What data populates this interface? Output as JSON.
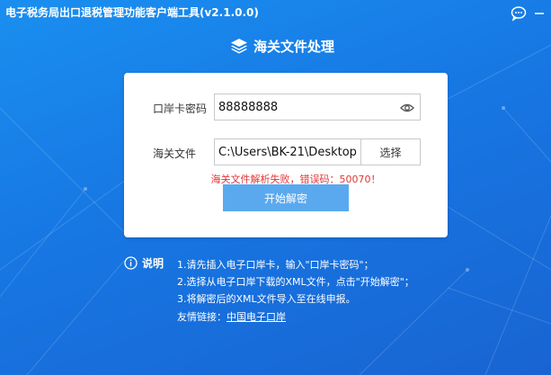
{
  "window": {
    "title": "电子税务局出口退税管理功能客户端工具(v2.1.0.0)"
  },
  "page": {
    "heading": "海关文件处理"
  },
  "form": {
    "password_label": "口岸卡密码",
    "password_value": "88888888",
    "file_label": "海关文件",
    "file_value": "C:\\Users\\BK-21\\Desktop",
    "browse_label": "选择",
    "error_text": "海关文件解析失败，错误码：50070！",
    "decrypt_label": "开始解密"
  },
  "info": {
    "title": "说明",
    "lines": [
      "1.请先插入电子口岸卡，输入\"口岸卡密码\"；",
      "2.选择从电子口岸下载的XML文件，点击\"开始解密\"；",
      "3.将解密后的XML文件导入至在线申报。"
    ],
    "friend_links_label": "友情链接：",
    "friend_link_text": "中国电子口岸"
  },
  "colors": {
    "background": "#1777e3",
    "button": "#5aa9ef",
    "error": "#e53333"
  },
  "icons": {
    "chat": "chat-bubble-icon",
    "minimize": "minimize-icon",
    "close": "close-icon",
    "heading": "layers-icon",
    "eye": "eye-icon",
    "info": "info-circle-icon"
  }
}
